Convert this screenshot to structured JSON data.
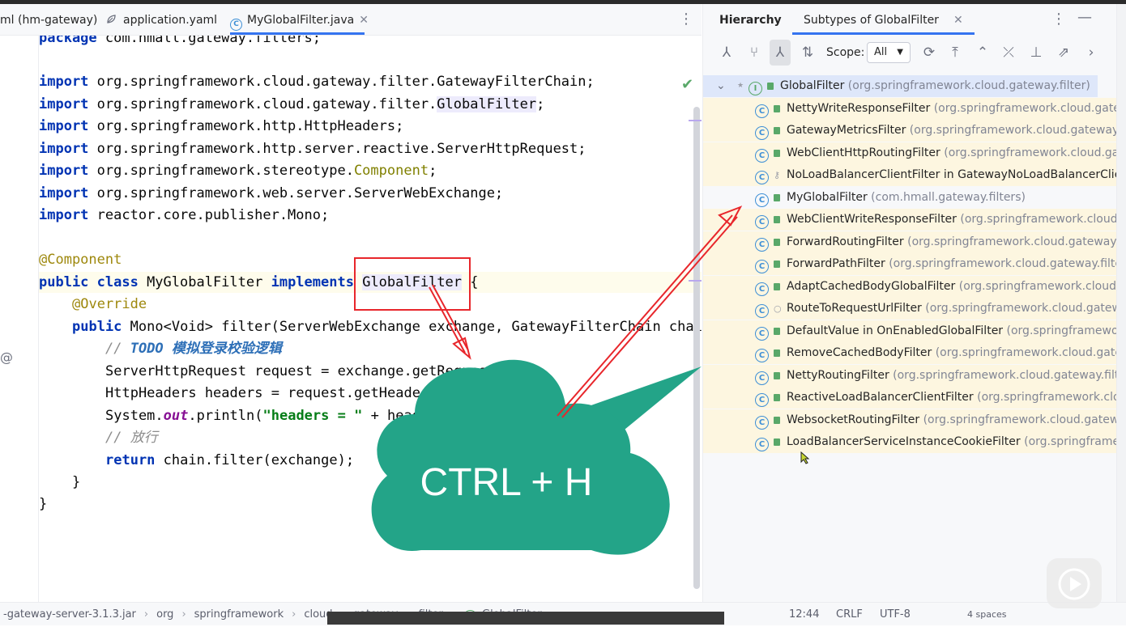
{
  "editor_tabs": [
    {
      "label": "ml (hm-gateway)",
      "active": false
    },
    {
      "label": "application.yaml",
      "active": false
    },
    {
      "label": "MyGlobalFilter.java",
      "active": true
    }
  ],
  "code_lines": {
    "l0_kw": "package",
    "l0_rest": " com.hmall.gateway.filters;",
    "l2_kw": "import",
    "l2_rest": " org.springframework.cloud.gateway.filter.GatewayFilterChain;",
    "l3_kw": "import",
    "l3_a": " org.springframework.cloud.gateway.filter.",
    "l3_hl": "GlobalFilter",
    "l3_b": ";",
    "l4_kw": "import",
    "l4_rest": " org.springframework.http.HttpHeaders;",
    "l5_kw": "import",
    "l5_rest": " org.springframework.http.server.reactive.ServerHttpRequest;",
    "l6_kw": "import",
    "l6_a": " org.springframework.stereotype.",
    "l6_comp": "Component",
    "l6_b": ";",
    "l7_kw": "import",
    "l7_rest": " org.springframework.web.server.ServerWebExchange;",
    "l8_kw": "import",
    "l8_rest": " reactor.core.publisher.Mono;",
    "l10": "@Component",
    "l11_kw1": "public class",
    "l11_a": " MyGlobalFilter ",
    "l11_kw2": "implements",
    "l11_sp": " ",
    "l11_hl": "GlobalFilter",
    "l11_b": " {",
    "l12": "@Override",
    "l13_kw": "public",
    "l13_rest": " Mono<Void> filter(ServerWebExchange exchange, GatewayFilterChain chai",
    "l14_c": "// ",
    "l14_todo": "TODO 模拟登录校验逻辑",
    "l15": "ServerHttpRequest request = exchange.getRequest();",
    "l16": "HttpHeaders headers = request.getHeaders();",
    "l17_a": "System.",
    "l17_fld": "out",
    "l17_b": ".println(",
    "l17_str": "\"headers = \"",
    "l17_c": " + headers);",
    "l18": "// 放行",
    "l19_kw": "return",
    "l19_rest": " chain.filter(exchange);",
    "l20": "}",
    "l21": "}"
  },
  "hierarchy": {
    "title": "Hierarchy",
    "tab": "Subtypes of GlobalFilter",
    "scope_label": "Scope:",
    "scope_value": "All",
    "root": {
      "name": "GlobalFilter",
      "pkg": "(org.springframework.cloud.gateway.filter)"
    },
    "items": [
      {
        "name": "NettyWriteResponseFilter",
        "pkg": "(org.springframework.cloud.gateway"
      },
      {
        "name": "GatewayMetricsFilter",
        "pkg": "(org.springframework.cloud.gateway.filt"
      },
      {
        "name": "WebClientHttpRoutingFilter",
        "pkg": "(org.springframework.cloud.gatew"
      },
      {
        "name": "NoLoadBalancerClientFilter in GatewayNoLoadBalancerClientA",
        "pkg": ""
      },
      {
        "name": "MyGlobalFilter",
        "pkg": "(com.hmall.gateway.filters)"
      },
      {
        "name": "WebClientWriteResponseFilter",
        "pkg": "(org.springframework.cloud.ga"
      },
      {
        "name": "ForwardRoutingFilter",
        "pkg": "(org.springframework.cloud.gateway.filt"
      },
      {
        "name": "ForwardPathFilter",
        "pkg": "(org.springframework.cloud.gateway.filter)"
      },
      {
        "name": "AdaptCachedBodyGlobalFilter",
        "pkg": "(org.springframework.cloud.ga"
      },
      {
        "name": "RouteToRequestUrlFilter",
        "pkg": "(org.springframework.cloud.gateway"
      },
      {
        "name": "DefaultValue in OnEnabledGlobalFilter",
        "pkg": "(org.springframework.c"
      },
      {
        "name": "RemoveCachedBodyFilter",
        "pkg": "(org.springframework.cloud.gatewa"
      },
      {
        "name": "NettyRoutingFilter",
        "pkg": "(org.springframework.cloud.gateway.filter)"
      },
      {
        "name": "ReactiveLoadBalancerClientFilter",
        "pkg": "(org.springframework.cloud"
      },
      {
        "name": "WebsocketRoutingFilter",
        "pkg": "(org.springframework.cloud.gateway."
      },
      {
        "name": "LoadBalancerServiceInstanceCookieFilter",
        "pkg": "(org.springframewo"
      }
    ]
  },
  "statusbar": {
    "crumbs": [
      "-gateway-server-3.1.3.jar",
      "org",
      "springframework",
      "cloud",
      "gateway",
      "filter",
      "GlobalFilter"
    ],
    "position": "12:44",
    "line_sep": "CRLF",
    "encoding": "UTF-8",
    "indent": "4 spaces"
  },
  "overlay": {
    "cloud_text": "CTRL + H"
  },
  "colors": {
    "cloud": "#23a488",
    "arrow": "#e8262b",
    "accent": "#3574f0"
  }
}
